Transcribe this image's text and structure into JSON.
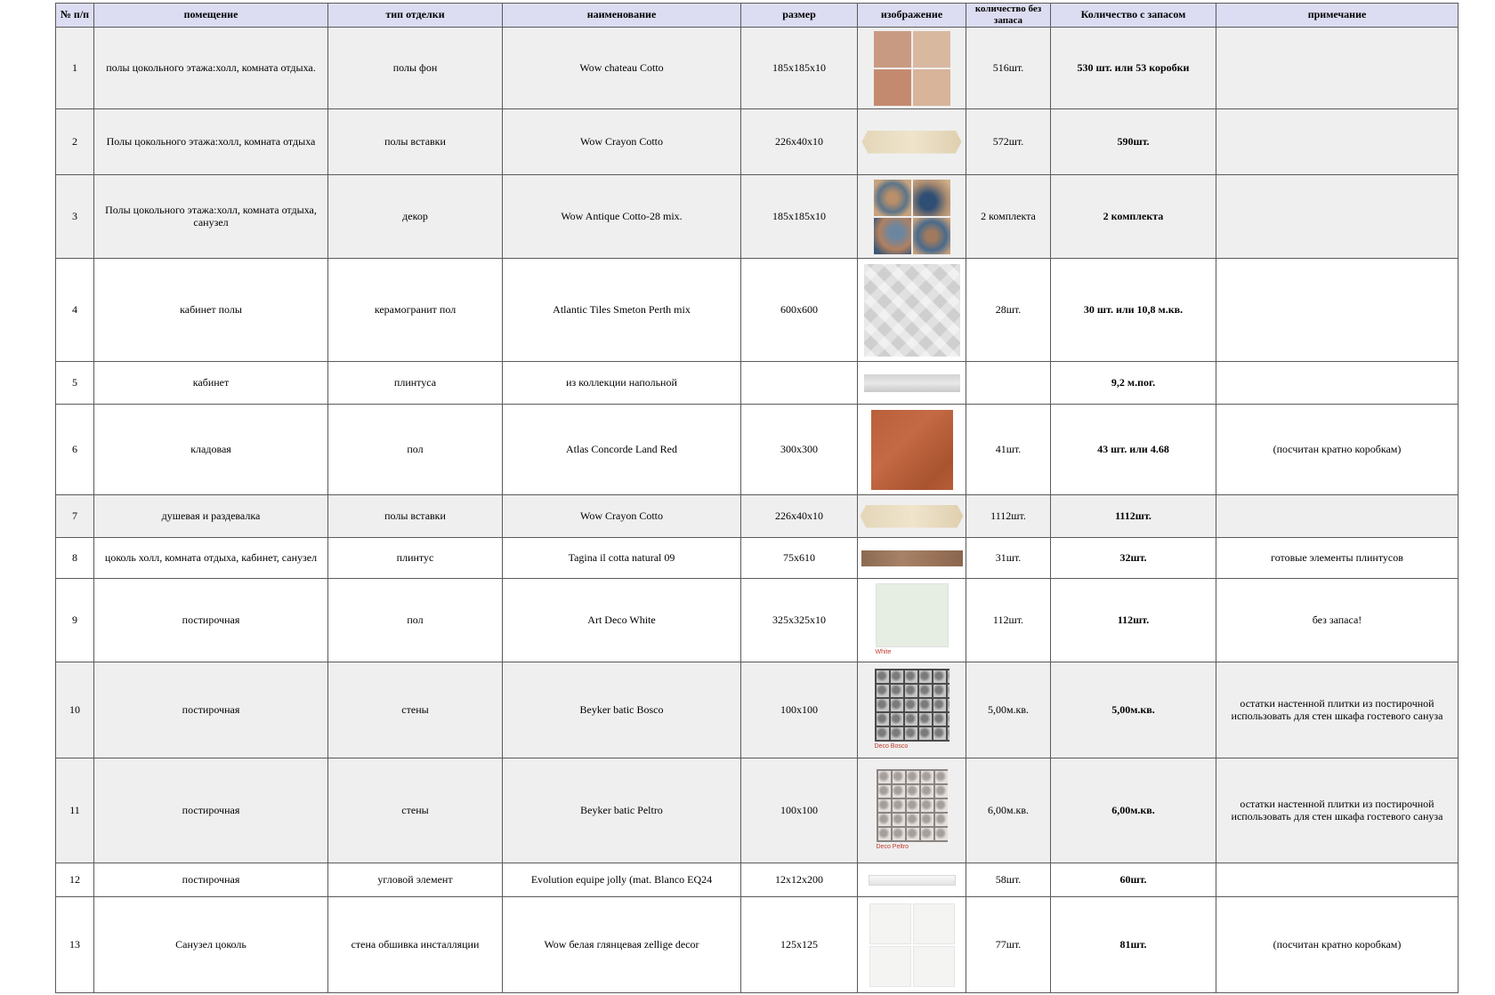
{
  "headers": [
    "№ п/п",
    "помещение",
    "тип отделки",
    "наименование",
    "размер",
    "изображение",
    "количество без запаса",
    "Количество с запасом",
    "примечание"
  ],
  "rows": [
    {
      "num": "1",
      "room": "полы цокольного этажа:холл, комната отдыха.",
      "finish": "полы фон",
      "name": "Wow chateau Cotto",
      "size": "185x185x10",
      "image": "chateau-cotto-tile",
      "image_caption": "",
      "qty": "516шт.",
      "qty_reserve": "530 шт. или 53 коробки",
      "note": ""
    },
    {
      "num": "2",
      "room": "Полы цокольного этажа:холл, комната отдыха",
      "finish": "полы вставки",
      "name": "Wow Crayon Cotto",
      "size": "226x40x10",
      "image": "crayon-cotto-strip",
      "image_caption": "",
      "qty": "572шт.",
      "qty_reserve": "590шт.",
      "note": ""
    },
    {
      "num": "3",
      "room": "Полы цокольного этажа:холл, комната отдыха, санузел",
      "finish": "декор",
      "name": "Wow Antique Cotto-28 mix.",
      "size": "185x185x10",
      "image": "antique-cotto-tile",
      "image_caption": "",
      "qty": "2 комплекта",
      "qty_reserve": "2 комплекта",
      "note": ""
    },
    {
      "num": "4",
      "room": "кабинет полы",
      "finish": "керамогранит пол",
      "name": "Atlantic Tiles Smeton Perth mix",
      "size": "600x600",
      "image": "perth-mix-tile",
      "image_caption": "",
      "qty": "28шт.",
      "qty_reserve": "30 шт. или 10,8 м.кв.",
      "note": ""
    },
    {
      "num": "5",
      "room": "кабинет",
      "finish": "плинтуса",
      "name": "из коллекции напольной",
      "size": "",
      "image": "grey-plinth",
      "image_caption": "",
      "qty": "",
      "qty_reserve": "9,2 м.пог.",
      "note": ""
    },
    {
      "num": "6",
      "room": "кладовая",
      "finish": "пол",
      "name": "Atlas Concorde Land Red",
      "size": "300x300",
      "image": "land-red-tile",
      "image_caption": "",
      "qty": "41шт.",
      "qty_reserve": "43 шт. или 4.68",
      "note": "(посчитан кратно коробкам)"
    },
    {
      "num": "7",
      "room": "душевая и раздевалка",
      "finish": "полы вставки",
      "name": "Wow Crayon Cotto",
      "size": "226x40x10",
      "image": "crayon-cotto-strip",
      "image_caption": "",
      "qty": "1112шт.",
      "qty_reserve": "1112шт.",
      "note": ""
    },
    {
      "num": "8",
      "room": "цоколь холл, комната отдыха, кабинет, санузел",
      "finish": "плинтус",
      "name": "Tagina il cotta natural 09",
      "size": "75x610",
      "image": "tagina-plinth",
      "image_caption": "",
      "qty": "31шт.",
      "qty_reserve": "32шт.",
      "note": "готовые элементы плинтусов"
    },
    {
      "num": "9",
      "room": "постирочная",
      "finish": "пол",
      "name": "Art Deco White",
      "size": "325x325x10",
      "image": "art-deco-white-tile",
      "image_caption": "White",
      "qty": "112шт.",
      "qty_reserve": "112шт.",
      "note": "без запаса!"
    },
    {
      "num": "10",
      "room": "постирочная",
      "finish": "стены",
      "name": "Beyker   batic Bosco",
      "size": "100x100",
      "image": "batic-bosco-tile",
      "image_caption": "Deco Bosco",
      "qty": "5,00м.кв.",
      "qty_reserve": "5,00м.кв.",
      "note": "остатки настенной плитки из постирочной использовать для стен шкафа гостевого сануза"
    },
    {
      "num": "11",
      "room": "постирочная",
      "finish": "стены",
      "name": "Beyker   batic Peltro",
      "size": "100x100",
      "image": "batic-peltro-tile",
      "image_caption": "Deco Peltro",
      "qty": "6,00м.кв.",
      "qty_reserve": "6,00м.кв.",
      "note": "остатки настенной плитки из постирочной использовать для стен шкафа гостевого сануза"
    },
    {
      "num": "12",
      "room": "постирочная",
      "finish": "угловой элемент",
      "name": "Evolution equipe jolly (mat. Blanco EQ24",
      "size": "12x12x200",
      "image": "jolly-corner-element",
      "image_caption": "",
      "qty": "58шт.",
      "qty_reserve": "60шт.",
      "note": ""
    },
    {
      "num": "13",
      "room": "Санузел цоколь",
      "finish": "стена обшивка инсталляции",
      "name": "Wow белая глянцевая  zellige decor",
      "size": "125x125",
      "image": "zellige-white-tile",
      "image_caption": "",
      "qty": "77шт.",
      "qty_reserve": "81шт.",
      "note": "(посчитан кратно коробкам)"
    }
  ],
  "colors": {
    "header_bg": "#dcdcf2",
    "row_shade": "#efefef",
    "border": "#5a5a5a",
    "caption": "#c0392b"
  }
}
